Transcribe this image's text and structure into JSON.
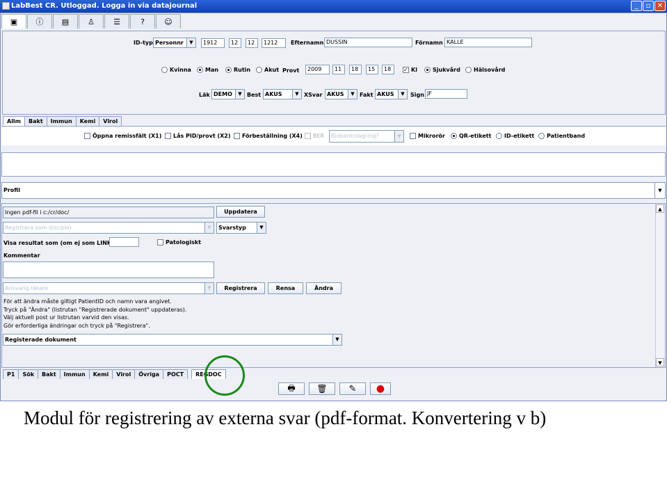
{
  "window": {
    "title": "LabBest CR. Utloggad. Logga in via datajournal",
    "min": "_",
    "max": "▫",
    "close": "✕"
  },
  "toolbar": {
    "icons": [
      "qr-icon",
      "info-icon",
      "document-icon",
      "user-icon",
      "list-icon",
      "help-icon",
      "message-icon"
    ],
    "glyphs": [
      "▣",
      "ⓘ",
      "▤",
      "♙",
      "☰",
      "?",
      "☺"
    ]
  },
  "patient": {
    "id_label": "ID-typ",
    "id_type": "Personnr",
    "pnr": [
      "1912",
      "12",
      "12",
      "1212"
    ],
    "lastname_label": "Efternamn",
    "lastname": "DUSSIN",
    "firstname_label": "Förnamn",
    "firstname": "KALLE",
    "gender": [
      {
        "label": "Kvinna",
        "on": false
      },
      {
        "label": "Man",
        "on": true
      }
    ],
    "priority": [
      {
        "label": "Rutin",
        "on": true
      },
      {
        "label": "Akut",
        "on": false
      }
    ],
    "provt_label": "Provt",
    "provt": [
      "2009",
      "11",
      "18",
      "15",
      "18"
    ],
    "kl_label": "Kl",
    "kl_checked": true,
    "care": [
      {
        "label": "Sjukvård",
        "on": true
      },
      {
        "label": "Hälsovård",
        "on": false
      }
    ],
    "lak_label": "Läk",
    "lak": "DEMO",
    "best_label": "Best",
    "best": "AKUS",
    "xsvar_label": "XSvar",
    "xsvar": "AKUS",
    "fakt_label": "Fakt",
    "fakt": "AKUS",
    "sign_label": "Sign",
    "sign": "JF"
  },
  "upper_tabs": [
    "Allm",
    "Bakt",
    "Immun",
    "Kemi",
    "Virol"
  ],
  "options": {
    "opt1": "Öppna remissfält (X1)",
    "opt2": "Lås PID/provt (X2)",
    "opt3": "Förbeställning (X4)",
    "ber": "BER",
    "biobank": "Biobankslagring?",
    "mikro": "Mikrorör",
    "qr": "QR-etikett",
    "idet": "ID-etikett",
    "pband": "Patientband"
  },
  "profile_label": "Profil",
  "form": {
    "pdf": "Ingen pdf-fil i c:/cr/doc/",
    "update": "Uppdatera",
    "discipline": "Registrera som disciplin",
    "svarstyp": "Svarstyp",
    "link_label": "Visa resultat som (om ej som LINK)",
    "pat": "Patologiskt",
    "comment_label": "Kommentar",
    "doctor": "Ansvarig läkare",
    "register": "Registrera",
    "clear": "Rensa",
    "change": "Ändra",
    "notes": [
      "För att ändra måste giltigt PatientID och namn vara angivet.",
      "Tryck på \"Ändra\" (listrutan \"Registrerade dokument\" uppdateras).",
      "Välj aktuell post ur listrutan varvid den visas.",
      "Gör erforderliga ändringar och tryck på \"Registrera\"."
    ],
    "registered": "Registerade dokument",
    "scroll_up": "▲",
    "scroll_down": "▼"
  },
  "bottom_tabs": [
    "P1",
    "Sök",
    "Bakt",
    "Immun",
    "Kemi",
    "Virol",
    "Övriga",
    "POCT",
    "REGDOC"
  ],
  "actions": [
    {
      "name": "print-icon",
      "g": "🖶"
    },
    {
      "name": "trash-icon",
      "g": "🗑"
    },
    {
      "name": "edit-icon",
      "g": "✎"
    },
    {
      "name": "stop-icon",
      "g": "●"
    }
  ],
  "highlight_color": "#1a8a1a",
  "caption": "Modul för registrering av externa svar (pdf-format. Konvertering v b)"
}
